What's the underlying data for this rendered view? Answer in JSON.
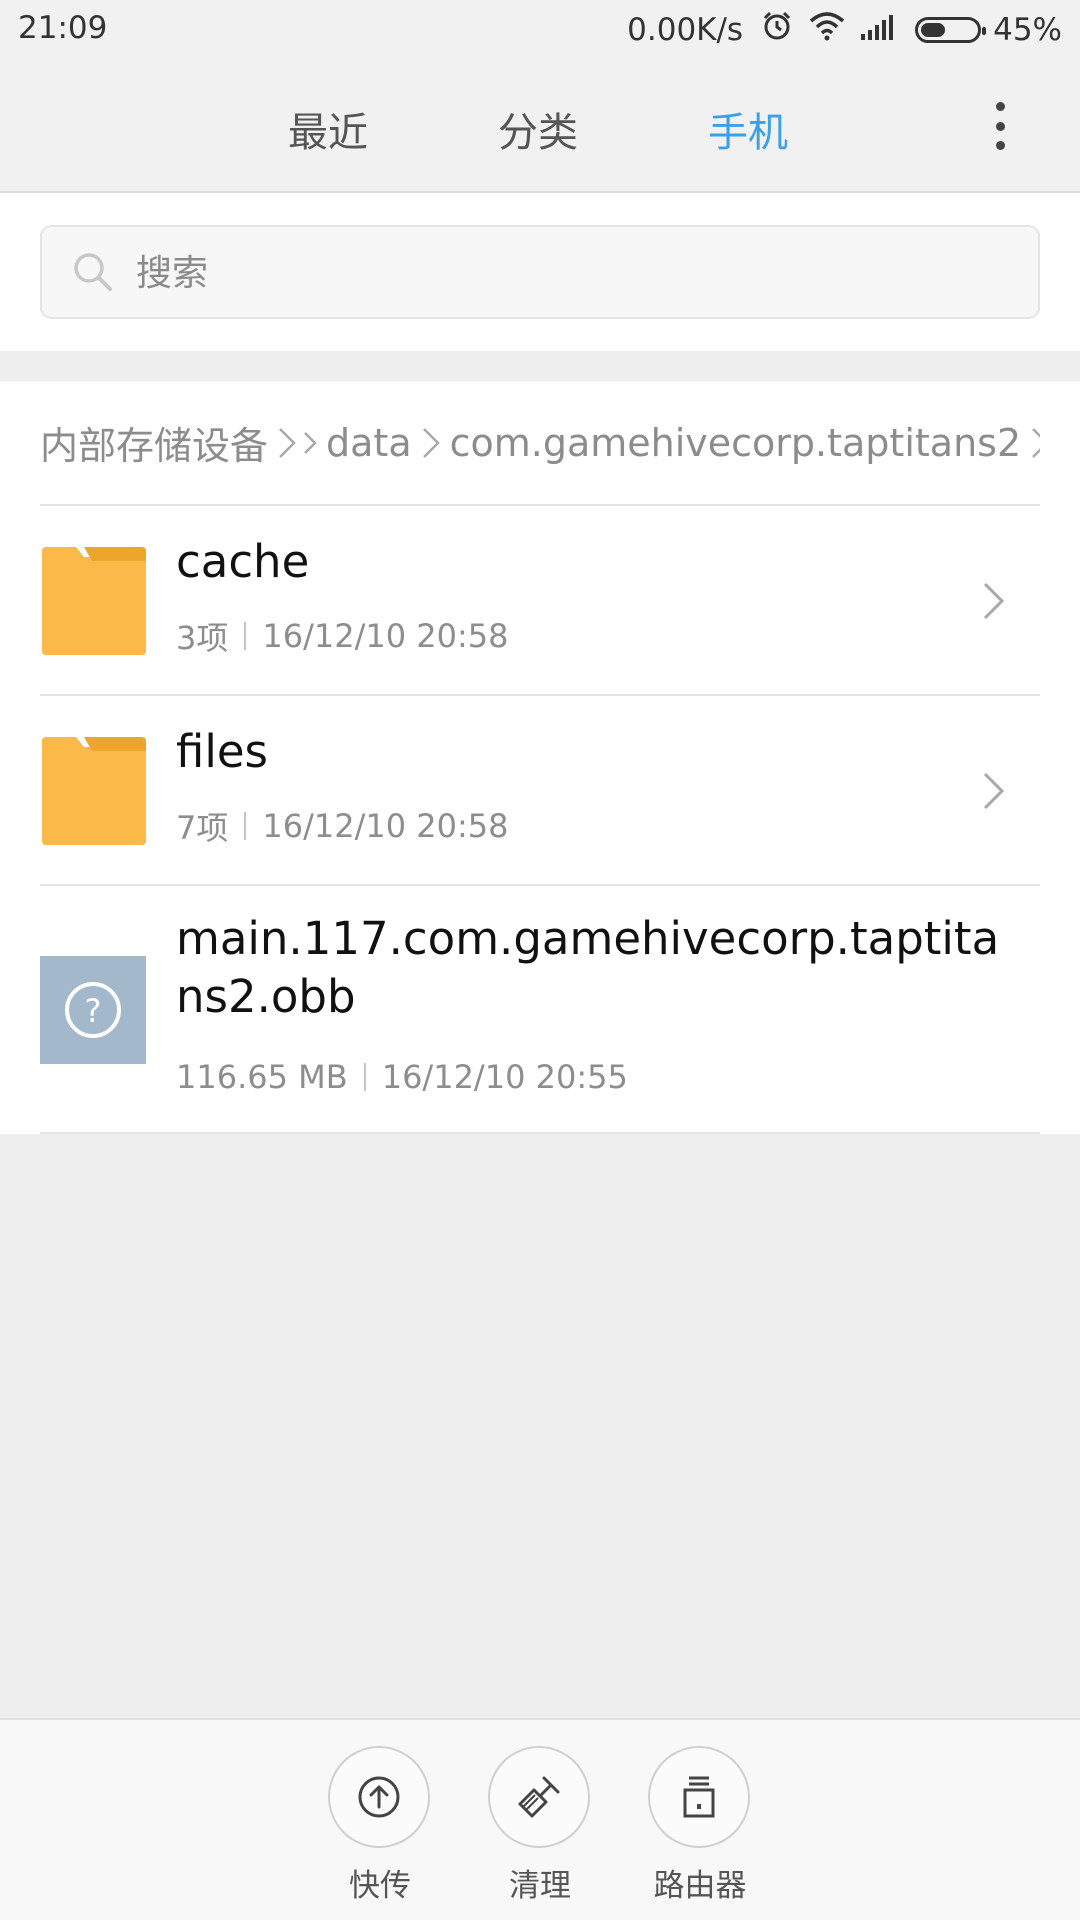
{
  "status_bar": {
    "time": "21:09",
    "net_speed": "0.00K/s",
    "battery_text": "45%",
    "battery_level": 0.45,
    "icons": [
      "alarm-icon",
      "wifi-icon",
      "signal-icon",
      "battery-icon"
    ]
  },
  "tabs": [
    {
      "label": "最近",
      "active": false
    },
    {
      "label": "分类",
      "active": false
    },
    {
      "label": "手机",
      "active": true
    }
  ],
  "search": {
    "placeholder": "搜索",
    "value": ""
  },
  "breadcrumb": [
    "内部存储设备",
    "data",
    "com.gamehivecorp.taptitans2"
  ],
  "files": [
    {
      "name": "cache",
      "type": "folder",
      "count": "3项",
      "date": "16/12/10 20:58"
    },
    {
      "name": "files",
      "type": "folder",
      "count": "7项",
      "date": "16/12/10 20:58"
    },
    {
      "name": "main.117.com.gamehivecorp.taptitans2.obb",
      "type": "unknown",
      "size": "116.65 MB",
      "date": "16/12/10 20:55"
    }
  ],
  "bottom_actions": [
    {
      "label": "快传",
      "icon": "upload-icon"
    },
    {
      "label": "清理",
      "icon": "broom-icon"
    },
    {
      "label": "路由器",
      "icon": "router-icon"
    }
  ],
  "colors": {
    "accent": "#3aa0e8",
    "folder": "#fbb94a",
    "folder_tab": "#eda52b",
    "unknown_file": "#a4b8cc"
  }
}
